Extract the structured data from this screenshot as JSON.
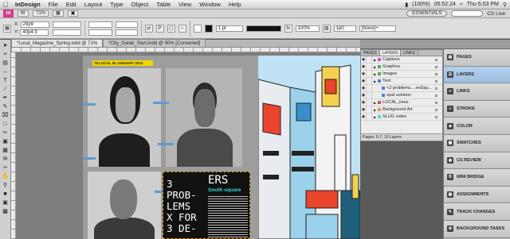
{
  "menubar": {
    "apple": "",
    "app": "InDesign",
    "items": [
      "File",
      "Edit",
      "Layout",
      "Type",
      "Object",
      "Table",
      "View",
      "Window",
      "Help"
    ],
    "battery": "(100%)",
    "time_left": "05:52:24",
    "clock": "Thu 6:03 PM"
  },
  "ctrlbar": {
    "logo": "Id",
    "zoom": "71%",
    "workspace": "ESSENTIALS",
    "cslive": "CS Live"
  },
  "options": {
    "x_label": "X:",
    "x_value": "29p9",
    "y_label": "Y:",
    "y_value": "40p4.9",
    "stroke_weight": "1 pt",
    "opacity": "100%",
    "size_value": "1p0",
    "style": "[None]+"
  },
  "tabs": [
    {
      "label": "*Local_Magazine_Spring.indd @ 71%"
    },
    {
      "label": "*City_Guide_Start.indd @ 90% [Converted]"
    }
  ],
  "spread": {
    "folio": "78     LOCAL IN JANUARY 2010",
    "big_text": "3\nPROB-\nLEMS\nX FOR\n3 DE-",
    "ers_text": "ERS",
    "subhead": "South square"
  },
  "layers_panel": {
    "tabs": [
      "PAGES",
      "LAYERS",
      "LINKS"
    ],
    "rows": [
      {
        "name": "Captions",
        "color": "#d84fd8",
        "indent": 0
      },
      {
        "name": "Graphics",
        "color": "#4cb04c",
        "indent": 0
      },
      {
        "name": "Images",
        "color": "#4cb04c",
        "indent": 0
      },
      {
        "name": "Text",
        "color": "#4f7bd8",
        "indent": 0
      },
      {
        "name": "<3 problems....enSqu...",
        "color": "#4f7bd8",
        "indent": 1
      },
      {
        "name": "opal solution",
        "color": "#4f7bd8",
        "indent": 1
      },
      {
        "name": "LOCAL_lines",
        "color": "#d84f4f",
        "indent": 0
      },
      {
        "name": "Background Art",
        "color": "#d8a04f",
        "indent": 0
      },
      {
        "name": "SLUG notes",
        "color": "#4fd8d8",
        "indent": 0
      }
    ],
    "status": "Pages: 6-7, 10 Layers"
  },
  "sidepanel": {
    "items": [
      "PAGES",
      "LAYERS",
      "LINKS",
      "STROKE",
      "COLOR",
      "SWATCHES",
      "CS REVIEW",
      "MINI BRIDGE",
      "ASSIGNMENTS",
      "TRACK CHANGES",
      "BACKGROUND TASKS"
    ]
  },
  "colors": {
    "yellow": "#f0d600",
    "blue": "#5b9bd5",
    "cyan": "#3ad4d4"
  }
}
